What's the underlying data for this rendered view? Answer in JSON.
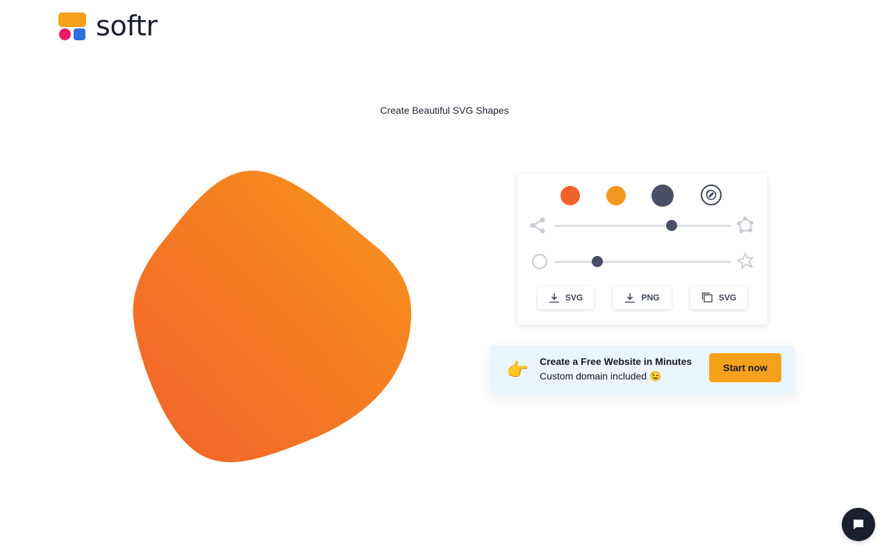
{
  "brand": {
    "name": "softr"
  },
  "page": {
    "title": "Create Beautiful SVG Shapes"
  },
  "shape": {
    "gradient_start": "#f2622b",
    "gradient_end": "#f7941d"
  },
  "palette": {
    "swatches": [
      {
        "name": "orange-red",
        "color": "#f2622b"
      },
      {
        "name": "orange",
        "color": "#f5981d"
      },
      {
        "name": "slate",
        "color": "#4a4f68"
      }
    ],
    "random_icon": "shuffle-icon"
  },
  "sliders": {
    "complexity": {
      "min_icon": "low-complexity-icon",
      "max_icon": "high-complexity-icon",
      "value": 0.66
    },
    "contrast": {
      "min_icon": "circle-icon",
      "max_icon": "star-shape-icon",
      "value": 0.24
    }
  },
  "downloads": {
    "svg_label": "SVG",
    "png_label": "PNG",
    "copy_svg_label": "SVG"
  },
  "promo": {
    "icon": "pointing-hand-icon",
    "hand": "👉",
    "title": "Create a Free Website in Minutes",
    "subtitle": "Custom domain included 😉",
    "cta_label": "Start now"
  },
  "chat": {
    "icon": "chat-icon"
  }
}
